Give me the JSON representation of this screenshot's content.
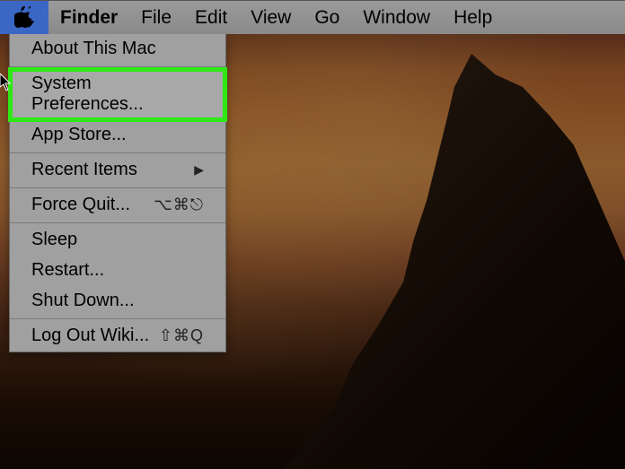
{
  "menubar": {
    "active_app": "Finder",
    "items": {
      "file": "File",
      "edit": "Edit",
      "view": "View",
      "go": "Go",
      "window": "Window",
      "help": "Help"
    }
  },
  "apple_menu": {
    "about": "About This Mac",
    "system_preferences": "System Preferences...",
    "app_store": "App Store...",
    "recent_items": "Recent Items",
    "force_quit": "Force Quit...",
    "force_quit_shortcut": "⌥⌘⎋",
    "sleep": "Sleep",
    "restart": "Restart...",
    "shut_down": "Shut Down...",
    "log_out": "Log Out Wiki...",
    "log_out_shortcut": "⇧⌘Q"
  }
}
